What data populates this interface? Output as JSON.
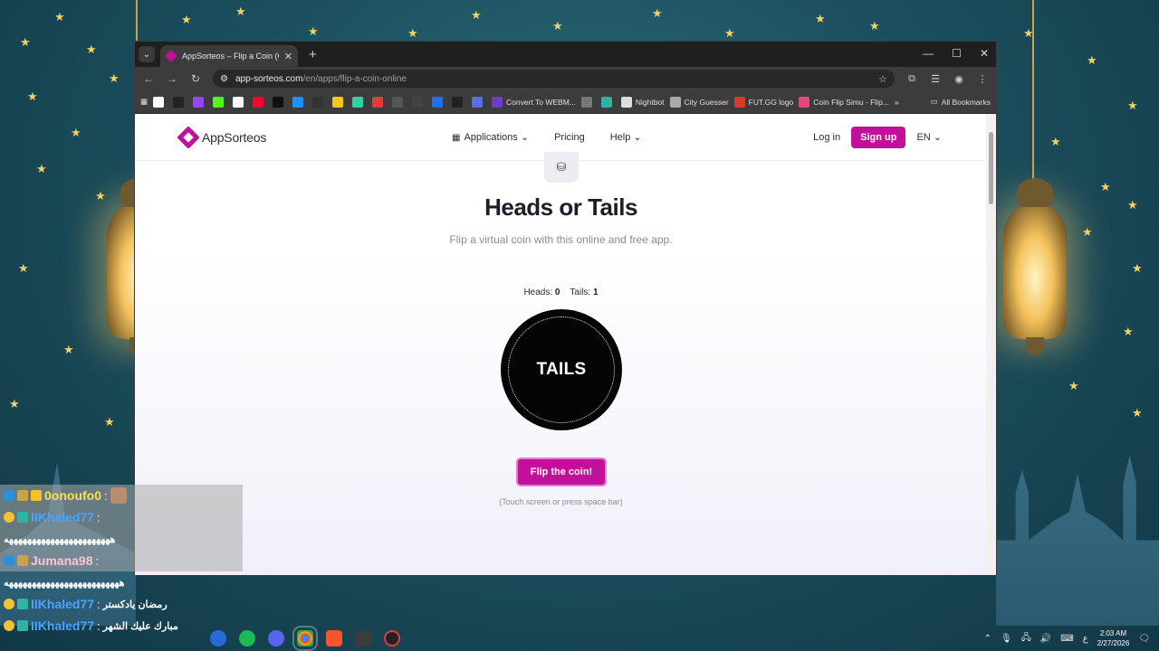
{
  "browser": {
    "tab_title": "AppSorteos – Flip a Coin (Coin",
    "url_domain": "app-sorteos.com",
    "url_path": "/en/apps/flip-a-coin-online",
    "bookmarks": [
      {
        "label": "",
        "color": "#ffffff"
      },
      {
        "label": "",
        "color": "#222222"
      },
      {
        "label": "",
        "color": "#9146ff"
      },
      {
        "label": "",
        "color": "#53fc18"
      },
      {
        "label": "",
        "color": "#ffffff"
      },
      {
        "label": "",
        "color": "#ff0033"
      },
      {
        "label": "",
        "color": "#111111"
      },
      {
        "label": "",
        "color": "#1e90ff"
      },
      {
        "label": "",
        "color": "#333333"
      },
      {
        "label": "",
        "color": "#f5c518"
      },
      {
        "label": "",
        "color": "#2fd3a3"
      },
      {
        "label": "",
        "color": "#e23b3b"
      },
      {
        "label": "",
        "color": "#555555"
      },
      {
        "label": "",
        "color": "#444444"
      },
      {
        "label": "",
        "color": "#1a73e8"
      },
      {
        "label": "",
        "color": "#222222"
      },
      {
        "label": "",
        "color": "#5b6ee1"
      },
      {
        "label": "Convert To WEBM...",
        "color": "#6a3fc6"
      },
      {
        "label": "",
        "color": "#777777"
      },
      {
        "label": "",
        "color": "#2fb3a3"
      },
      {
        "label": "Nightbot",
        "color": "#dddddd"
      },
      {
        "label": "City Guesser",
        "color": "#aaaaaa"
      },
      {
        "label": "FUT.GG logo",
        "color": "#d83a2a"
      },
      {
        "label": "Coin Flip Simu - Flip...",
        "color": "#e04a7a"
      }
    ],
    "all_bookmarks": "All Bookmarks"
  },
  "site": {
    "logo": "AppSorteos",
    "nav": {
      "applications": "Applications",
      "pricing": "Pricing",
      "help": "Help"
    },
    "login": "Log in",
    "signup": "Sign up",
    "lang": "EN"
  },
  "hero": {
    "title": "Heads or Tails",
    "subtitle": "Flip a virtual coin with this online and free app."
  },
  "score": {
    "heads_label": "Heads:",
    "heads": "0",
    "tails_label": "Tails:",
    "tails": "1"
  },
  "coin": {
    "face": "TAILS"
  },
  "flip_button": "Flip the coin!",
  "hint": "(Touch screen or press space bar)",
  "chat": [
    {
      "user": "0onoufo0",
      "colon": ":",
      "msg": "",
      "color": "yellow",
      "highlight": true,
      "avatar": true
    },
    {
      "user": "IIKhaled77",
      "colon": ":",
      "msg": "",
      "color": "blue",
      "highlight": true
    },
    {
      "user": "",
      "colon": "",
      "msg": "هههههههههههههههههههههههه",
      "color": "blue",
      "highlight": true
    },
    {
      "user": "Jumana98",
      "colon": ":",
      "msg": "",
      "color": "pink",
      "highlight": true
    },
    {
      "user": "",
      "colon": "",
      "msg": "هههههههههههههههههههههههههه",
      "color": "pink",
      "highlight": false
    },
    {
      "user": "IIKhaled77",
      "colon": ":",
      "msg": "رمضان يادكستر",
      "color": "blue",
      "highlight": false
    },
    {
      "user": "IIKhaled77",
      "colon": ":",
      "msg": "مبارك عليك الشهر",
      "color": "blue",
      "highlight": false
    }
  ],
  "taskbar": {
    "time": "2:03 AM",
    "date": "2/27/2026",
    "lang": "ع"
  }
}
